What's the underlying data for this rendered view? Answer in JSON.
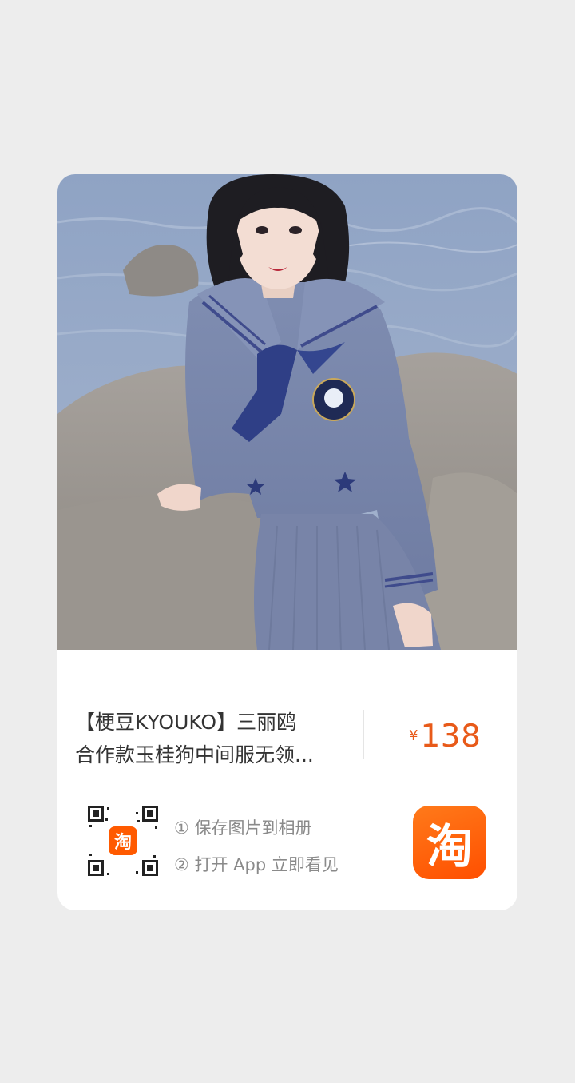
{
  "product": {
    "title_line1": "【梗豆KYOUKO】三丽鸥",
    "title_line2": "合作款玉桂狗中间服无领...",
    "currency": "¥",
    "price": "138"
  },
  "share": {
    "step1": "① 保存图片到相册",
    "step2": "② 打开 App 立即看见",
    "qr_center_badge": "淘"
  },
  "app_icon": {
    "glyph": "淘",
    "color": "#ff5a00"
  },
  "colors": {
    "background": "#ededed",
    "price": "#e85a19",
    "accent": "#ff5a00"
  }
}
